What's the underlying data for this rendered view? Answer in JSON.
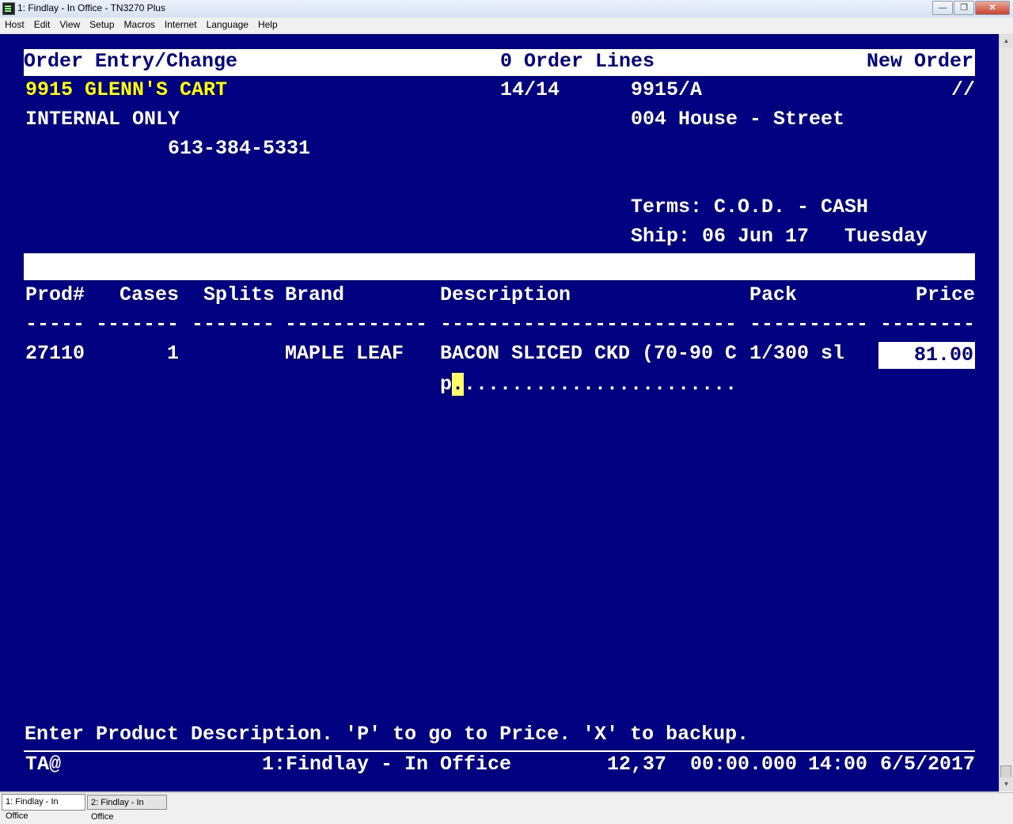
{
  "window": {
    "title": "1: Findlay - In Office - TN3270 Plus"
  },
  "menu": [
    "Host",
    "Edit",
    "View",
    "Setup",
    "Macros",
    "Internet",
    "Language",
    "Help"
  ],
  "screen": {
    "header": {
      "title": "Order Entry/Change",
      "order_lines": "0 Order Lines",
      "mode": "New Order"
    },
    "customer": {
      "name": "9915 GLENN'S CART",
      "count": "14/14",
      "account": "9915/A",
      "date_field": "//",
      "note": "INTERNAL ONLY",
      "route": "004 House - Street",
      "phone": "613-384-5331",
      "terms": "Terms: C.O.D. - CASH",
      "ship": "Ship: 06 Jun 17   Tuesday"
    },
    "columns": {
      "prod": "Prod#",
      "cases": "Cases",
      "splits": "Splits",
      "brand": "Brand",
      "description": "Description",
      "pack": "Pack",
      "price": "Price"
    },
    "dashes": {
      "prod": "-----",
      "cases": "-------",
      "splits": "-------",
      "brand": "------------",
      "description": "-------------------------",
      "pack": "----------",
      "price": "--------"
    },
    "line": {
      "prod": "27110",
      "cases": "1",
      "brand": "MAPLE LEAF",
      "description": "BACON SLICED CKD (70-90 C",
      "pack": "1/300 sl",
      "price": "81.00"
    },
    "input": {
      "typed": "p",
      "cursor_char": ".",
      "fill": "......................."
    },
    "prompt": "Enter Product Description. 'P' to go to Price. 'X' to backup.",
    "status": {
      "left": "TA@",
      "session": "1:Findlay - In Office",
      "cursor_pos": "12,37",
      "timer": "00:00.000",
      "time": "14:00",
      "date": "6/5/2017"
    }
  },
  "tabs": [
    "1: Findlay - In Office",
    "2: Findlay - In Office"
  ]
}
